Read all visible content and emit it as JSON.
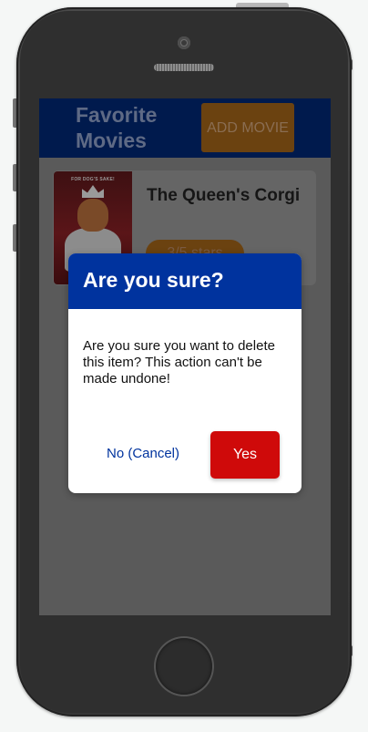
{
  "app": {
    "title": "Favorite Movies",
    "add_button_label": "ADD MOVIE"
  },
  "movies": [
    {
      "title": "The Queen's Corgi",
      "rating": "3/5 stars",
      "poster_tagline": "FOR DOG'S SAKE!"
    }
  ],
  "modal": {
    "title": "Are you sure?",
    "message": "Are you sure you want to delete this item? This action can't be made undone!",
    "cancel_label": "No (Cancel)",
    "confirm_label": "Yes"
  },
  "colors": {
    "header_bg": "#001a4d",
    "modal_header_bg": "#00339e",
    "accent_orange": "#6b4210",
    "confirm_red": "#cf0a0a"
  },
  "icons": [
    "camera-icon",
    "speaker-icon",
    "home-button-icon"
  ]
}
